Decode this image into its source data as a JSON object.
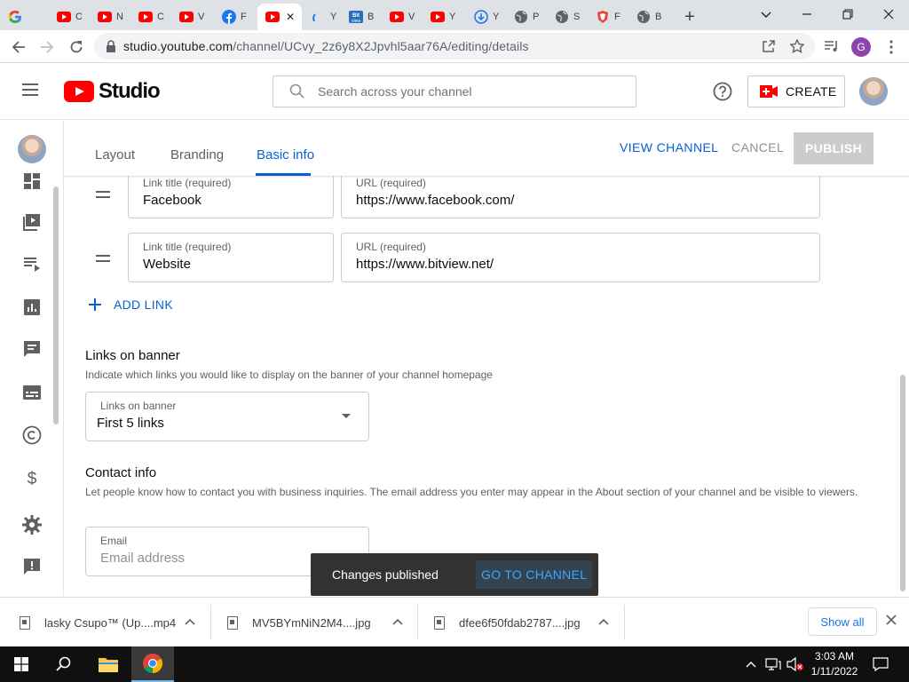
{
  "browser": {
    "tabs": [
      {
        "label": "G",
        "icon": "google-icon"
      },
      {
        "label": "C",
        "icon": "youtube-icon"
      },
      {
        "label": "N",
        "icon": "youtube-icon"
      },
      {
        "label": "C",
        "icon": "youtube-icon"
      },
      {
        "label": "V",
        "icon": "youtube-icon"
      },
      {
        "label": "F",
        "icon": "facebook-icon"
      },
      {
        "label": "",
        "icon": "youtube-icon",
        "active": true
      },
      {
        "label": "Y",
        "icon": "loading-icon"
      },
      {
        "label": "B",
        "icon": "bitview-icon"
      },
      {
        "label": "V",
        "icon": "youtube-icon"
      },
      {
        "label": "Y",
        "icon": "youtube-icon"
      },
      {
        "label": "Y",
        "icon": "download-cloud-icon"
      },
      {
        "label": "P",
        "icon": "globe-icon"
      },
      {
        "label": "S",
        "icon": "globe-icon"
      },
      {
        "label": "F",
        "icon": "brave-shield-icon"
      },
      {
        "label": "B",
        "icon": "globe-icon"
      }
    ],
    "url_host": "studio.youtube.com",
    "url_path": "/channel/UCvy_2z6y8X2Jpvhl5aar76A/editing/details",
    "profile_initial": "G"
  },
  "studio": {
    "logo_text": "Studio",
    "search_placeholder": "Search across your channel",
    "create_label": "CREATE"
  },
  "editor": {
    "tabs": [
      "Layout",
      "Branding",
      "Basic info"
    ],
    "active_tab": "Basic info",
    "view_channel_label": "VIEW CHANNEL",
    "cancel_label": "CANCEL",
    "publish_label": "PUBLISH",
    "links": [
      {
        "title_label": "Link title (required)",
        "title_value": "Facebook",
        "url_label": "URL (required)",
        "url_value": "https://www.facebook.com/"
      },
      {
        "title_label": "Link title (required)",
        "title_value": "Website",
        "url_label": "URL (required)",
        "url_value": "https://www.bitview.net/"
      }
    ],
    "add_link_label": "ADD LINK",
    "links_on_banner": {
      "title": "Links on banner",
      "description": "Indicate which links you would like to display on the banner of your channel homepage",
      "field_label": "Links on banner",
      "selected": "First 5 links"
    },
    "contact_info": {
      "title": "Contact info",
      "description": "Let people know how to contact you with business inquiries. The email address you enter may appear in the About section of your channel and be visible to viewers.",
      "email_label": "Email",
      "email_placeholder": "Email address"
    }
  },
  "snackbar": {
    "message": "Changes published",
    "action": "GO TO CHANNEL"
  },
  "downloads": {
    "items": [
      {
        "name": "lasky Csupo™ (Up....mp4"
      },
      {
        "name": "MV5BYmNiN2M4....jpg"
      },
      {
        "name": "dfee6f50fdab2787....jpg"
      }
    ],
    "show_all_label": "Show all"
  },
  "taskbar": {
    "time": "3:03 AM",
    "date": "1/11/2022"
  },
  "colors": {
    "accent_blue": "#065fd4",
    "youtube_red": "#ff0000",
    "snackbar_bg": "#323232"
  }
}
